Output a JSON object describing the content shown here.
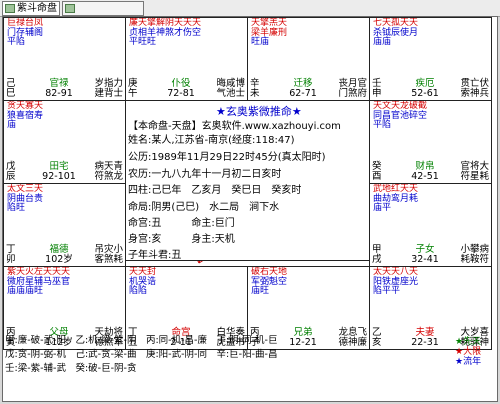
{
  "tabs": [
    {
      "label": "紫斗命盘",
      "active": true
    },
    {
      "label": "",
      "active": false
    }
  ],
  "center": {
    "title": "玄奥紫微推命",
    "header": "【本命盘-天盘】玄奥软件.www.xazhouyi.com",
    "lines": [
      "姓名:某人,江苏省-南京(经度:118:47)",
      "公历:1989年11月29日22时45分(真太阳时)",
      "农历:一九八九年十一月初二日亥时",
      "四柱:己巳年　乙亥月　癸巳日　癸亥时",
      "命局:阴男(己巳)　水二局　涧下水",
      "命宫:丑　　　命主:巨门",
      "身宫:亥　　　身主:天机",
      "子年斗君:丑"
    ]
  },
  "palaces": [
    {
      "stars": [
        [
          "巨禄",
          "台凤"
        ],
        [
          "门存",
          "辅阁"
        ],
        [
          "平",
          "陷"
        ]
      ],
      "colors": [
        "red",
        "blue",
        "blue"
      ],
      "left": [
        "己",
        "巳"
      ],
      "mid": [
        "官禄",
        "82-91"
      ],
      "right": [
        "岁指力",
        "建背士"
      ]
    },
    {
      "stars": [
        [
          "廉天",
          "擎解",
          "阴天",
          "天天"
        ],
        [
          "贞相",
          "羊神",
          "煞才",
          "伤空"
        ],
        [
          "平旺",
          "旺"
        ]
      ],
      "colors": [
        "red",
        "blue",
        "blue"
      ],
      "left": [
        "庚",
        "午"
      ],
      "mid": [
        "仆役",
        "72-81"
      ],
      "right": [
        "晦咸博",
        "气池士"
      ]
    },
    {
      "stars": [
        [
          "天",
          "擎",
          "羔",
          "天"
        ],
        [
          "梁",
          "羊",
          "廉",
          "刑"
        ],
        [
          "旺",
          "庙"
        ]
      ],
      "colors": [
        "red",
        "red",
        "blue"
      ],
      "left": [
        "辛",
        "未"
      ],
      "mid": [
        "迁移",
        "62-71"
      ],
      "right": [
        "丧月官",
        "门煞府"
      ]
    },
    {
      "stars": [
        [
          "七天",
          "孤天",
          "天"
        ],
        [
          "杀钺",
          "辰使",
          "月"
        ],
        [
          "庙",
          "庙"
        ]
      ],
      "colors": [
        "red",
        "blue",
        "blue"
      ],
      "left": [
        "壬",
        "申"
      ],
      "mid": [
        "疾厄",
        "52-61"
      ],
      "right": [
        "贯亡伏",
        "索神兵"
      ]
    },
    {
      "stars": [
        [
          "贪天",
          "寡天"
        ],
        [
          "狼喜",
          "宿寿"
        ],
        [
          "庙"
        ]
      ],
      "colors": [
        "red",
        "blue",
        "blue"
      ],
      "left": [
        "戊",
        "辰"
      ],
      "mid": [
        "田宅",
        "92-101"
      ],
      "right": [
        "病天青",
        "符煞龙"
      ]
    },
    {
      "stars": [
        [
          "天",
          "文",
          "天",
          "龙",
          "破",
          "截"
        ],
        [
          "同",
          "昌",
          "官",
          "池",
          "碎",
          "空"
        ],
        [
          "平",
          "陷"
        ]
      ],
      "colors": [
        "red",
        "blue",
        "blue"
      ],
      "left": [
        "癸",
        "酉"
      ],
      "mid": [
        "财帛",
        "42-51"
      ],
      "right": [
        "官将大",
        "符星耗"
      ]
    },
    {
      "stars": [
        [
          "太",
          "文",
          "三",
          "天"
        ],
        [
          "阴",
          "曲",
          "台",
          "贵"
        ],
        [
          "陷",
          "旺"
        ]
      ],
      "colors": [
        "red",
        "blue",
        "blue"
      ],
      "left": [
        "丁",
        "卯"
      ],
      "mid": [
        "福德",
        "102岁"
      ],
      "right": [
        "吊灾小",
        "客煞耗"
      ]
    },
    {
      "stars": [
        [
          "武",
          "地",
          "红",
          "天",
          "天"
        ],
        [
          "曲",
          "劫",
          "鸾",
          "月",
          "耗"
        ],
        [
          "庙",
          "平"
        ]
      ],
      "colors": [
        "red",
        "blue",
        "blue"
      ],
      "left": [
        "甲",
        "戌"
      ],
      "mid": [
        "子女",
        "32-41"
      ],
      "right": [
        "小攀病",
        "耗鞍符"
      ]
    },
    {
      "stars": [
        [
          "紫天",
          "火左",
          "天天",
          "天"
        ],
        [
          "微府",
          "星辅",
          "马",
          "巫官"
        ],
        [
          "庙",
          "庙",
          "庙",
          "旺"
        ]
      ],
      "colors": [
        "red",
        "blue",
        "blue"
      ],
      "left": [
        "丙",
        "寅"
      ],
      "mid": [
        "父母",
        "112岁"
      ],
      "right": [
        "天劫将",
        "德煞军"
      ]
    },
    {
      "stars": [
        [
          "天",
          "天",
          "封"
        ],
        [
          "机",
          "哭",
          "诰"
        ],
        [
          "陷",
          "陷"
        ]
      ],
      "colors": [
        "red",
        "blue",
        "blue"
      ],
      "left": [
        "丁",
        "丑"
      ],
      "mid": [
        "命宫",
        "2-11"
      ],
      "right": [
        "白华奏",
        "虎盖书"
      ]
    },
    {
      "stars": [
        [
          "破",
          "右",
          "天",
          "地"
        ],
        [
          "军",
          "弼",
          "魁",
          "空"
        ],
        [
          "庙",
          "旺"
        ]
      ],
      "colors": [
        "red",
        "blue",
        "blue"
      ],
      "left": [
        "丙",
        "子"
      ],
      "mid": [
        "兄弟",
        "12-21"
      ],
      "right": [
        "龙息飞",
        "德神廉"
      ]
    },
    {
      "stars": [
        [
          "太",
          "天",
          "天",
          "八",
          "天"
        ],
        [
          "阳",
          "铁",
          "虚",
          "座",
          "光"
        ],
        [
          "陷",
          "平",
          "平"
        ]
      ],
      "colors": [
        "red",
        "blue",
        "blue"
      ],
      "left": [
        "乙",
        "亥"
      ],
      "mid": [
        "夫妻",
        "22-31"
      ],
      "right": [
        "大岁喜",
        "耗驿神"
      ]
    }
  ],
  "footer": [
    "甲:廉-破-武-阳　乙:机-梁-紫-阴　丙:同-机-昌-廉　丁:阴-同-机-巨",
    "戊:贪-阴-弼-机　己:武-贪-梁-曲　庚:阳-武-阴-同　辛:巨-阳-曲-昌",
    "壬:梁-紫-辅-武　癸:破-巨-阴-贪"
  ],
  "legend": [
    {
      "label": "先天",
      "color": "#008000"
    },
    {
      "label": "大限",
      "color": "#d40000"
    },
    {
      "label": "流年",
      "color": "#0000cc"
    }
  ]
}
